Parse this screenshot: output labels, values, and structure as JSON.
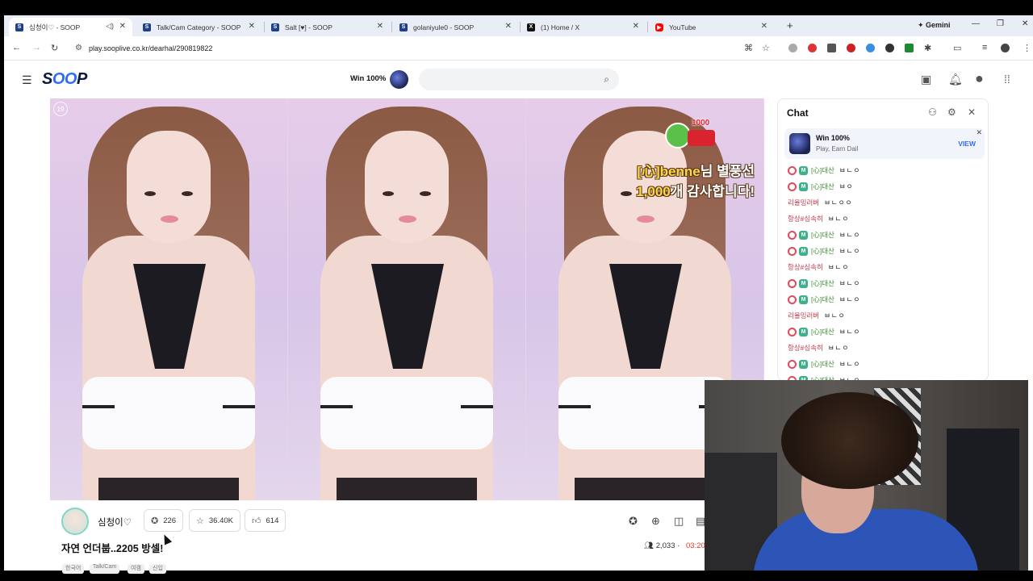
{
  "tabs": [
    {
      "title": "심청이♡ - SOOP",
      "icon": "soop-favicon",
      "active": true
    },
    {
      "title": "Talk/Cam Category - SOOP",
      "icon": "soop-favicon"
    },
    {
      "title": "Salt [♥] - SOOP",
      "icon": "soop-favicon"
    },
    {
      "title": "golaniyule0 - SOOP",
      "icon": "soop-favicon"
    },
    {
      "title": "(1) Home / X",
      "icon": "x-favicon"
    },
    {
      "title": "YouTube",
      "icon": "youtube-favicon"
    }
  ],
  "gemini_label": "Gemini",
  "url": "play.sooplive.co.kr/dearhal/290819822",
  "site": {
    "logo_pre": "S",
    "logo_mid": "OO",
    "logo_post": "P",
    "win_label": "Win 100%",
    "search_placeholder": ""
  },
  "video": {
    "age_badge": "19",
    "sticker_count": "1000",
    "overlay_line1_hl": "[心]benne",
    "overlay_line1_rest": "님 별풍선",
    "overlay_line2_hl": "1,000",
    "overlay_line2_rest": "개 감사합니다!"
  },
  "streamer": {
    "name": "심청이♡",
    "pill_chat_count": "226",
    "pill_fav_count": "36.40K",
    "pill_like_count": "614",
    "title": "자연 언더붑..2205 방셀!",
    "tags": [
      "한국어",
      "Talk/Cam",
      "여캠",
      "신입"
    ],
    "viewers": "2,033",
    "elapsed": "03:20"
  },
  "chat": {
    "title": "Chat",
    "promo_title": "Win 100%",
    "promo_sub": "Play, Earn Dail",
    "promo_view": "VIEW",
    "messages": [
      {
        "nick": "[心]대산",
        "msg": "ㅂㄴㅇ",
        "badges": true,
        "color": "#3a8f2f"
      },
      {
        "nick": "[心]대산",
        "msg": "ㅂㅇ",
        "badges": true,
        "color": "#3a8f2f"
      },
      {
        "nick": "리율밍러버",
        "msg": "ㅂㄴㅇㅇ",
        "badges": false,
        "color": "#c4384a"
      },
      {
        "nick": "항상#싱속히",
        "msg": "ㅂㄴㅇ",
        "badges": false,
        "color": "#c4384a"
      },
      {
        "nick": "[心]대산",
        "msg": "ㅂㄴㅇ",
        "badges": true,
        "color": "#3a8f2f"
      },
      {
        "nick": "[心]대산",
        "msg": "ㅂㄴㅇ",
        "badges": true,
        "color": "#3a8f2f"
      },
      {
        "nick": "항상#싱속히",
        "msg": "ㅂㄴㅇ",
        "badges": false,
        "color": "#c4384a"
      },
      {
        "nick": "[心]대산",
        "msg": "ㅂㄴㅇ",
        "badges": true,
        "color": "#3a8f2f"
      },
      {
        "nick": "[心]대산",
        "msg": "ㅂㄴㅇ",
        "badges": true,
        "color": "#3a8f2f"
      },
      {
        "nick": "리율밍러버",
        "msg": "ㅂㄴㅇ",
        "badges": false,
        "color": "#c4384a"
      },
      {
        "nick": "[心]대산",
        "msg": "ㅂㄴㅇ",
        "badges": true,
        "color": "#3a8f2f"
      },
      {
        "nick": "항상#싱속히",
        "msg": "ㅂㄴㅇ",
        "badges": false,
        "color": "#c4384a"
      },
      {
        "nick": "[心]대산",
        "msg": "ㅂㄴㅇ",
        "badges": true,
        "color": "#3a8f2f"
      },
      {
        "nick": "[心]대산",
        "msg": "ㅂㄴㅇ",
        "badges": true,
        "color": "#3a8f2f"
      }
    ]
  },
  "colors": {
    "brand_blue": "#2f6df6",
    "accent_red": "#e2382c"
  }
}
